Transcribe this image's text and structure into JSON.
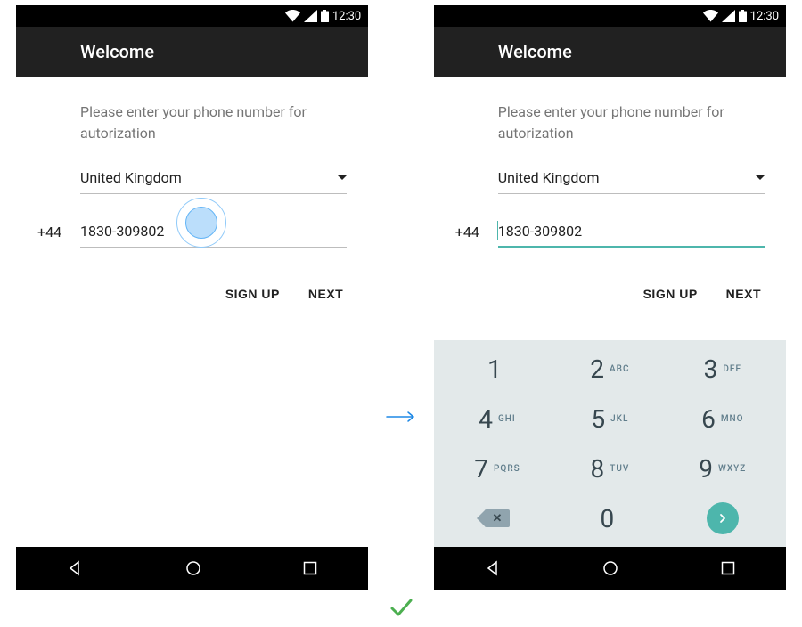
{
  "status": {
    "time": "12:30"
  },
  "header": {
    "title": "Welcome"
  },
  "instruction": "Please enter your phone number for autorization",
  "country": {
    "selected": "United Kingdom",
    "dial_code": "+44"
  },
  "phone": {
    "value": "1830-309802"
  },
  "actions": {
    "signup": "SIGN UP",
    "next": "NEXT"
  },
  "keypad": {
    "keys": [
      {
        "digit": "1",
        "letters": ""
      },
      {
        "digit": "2",
        "letters": "ABC"
      },
      {
        "digit": "3",
        "letters": "DEF"
      },
      {
        "digit": "4",
        "letters": "GHI"
      },
      {
        "digit": "5",
        "letters": "JKL"
      },
      {
        "digit": "6",
        "letters": "MNO"
      },
      {
        "digit": "7",
        "letters": "PQRS"
      },
      {
        "digit": "8",
        "letters": "TUV"
      },
      {
        "digit": "9",
        "letters": "WXYZ"
      },
      {
        "digit": "0",
        "letters": ""
      }
    ]
  },
  "colors": {
    "accent": "#4db6ac",
    "keypad_bg": "#e3e9ea",
    "ripple": "#bbdefb"
  }
}
